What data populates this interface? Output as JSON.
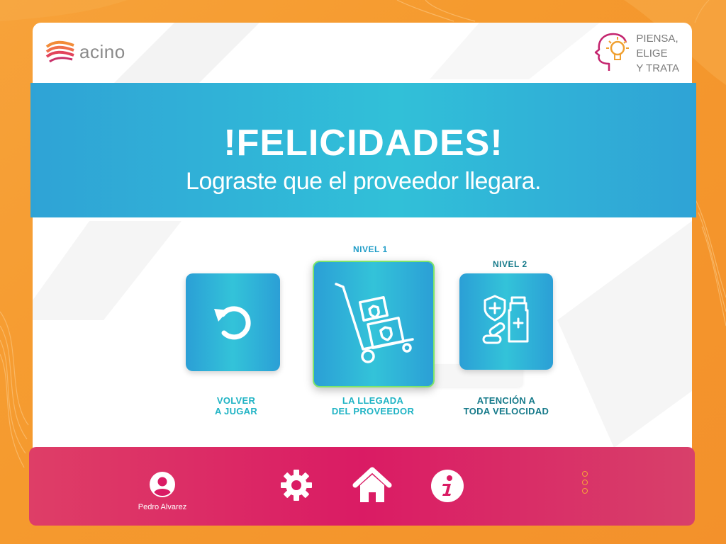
{
  "header": {
    "logo_text": "acino",
    "brand_text": "PIENSA,\nELIGE\nY TRATA"
  },
  "banner": {
    "title": "!FELICIDADES!",
    "subtitle": "Lograste que el proveedor llegara."
  },
  "tiles": [
    {
      "level": "",
      "caption": "VOLVER\nA JUGAR",
      "icon": "replay-icon"
    },
    {
      "level": "NIVEL 1",
      "caption": "LA LLEGADA\nDEL PROVEEDOR",
      "icon": "hand-truck-icon",
      "selected": true
    },
    {
      "level": "NIVEL 2",
      "caption": "ATENCIÓN A\nTODA VELOCIDAD",
      "icon": "medicine-icon"
    }
  ],
  "footer": {
    "user_name": "Pedro Alvarez",
    "icons": [
      "user-avatar-icon",
      "gear-icon",
      "home-icon",
      "info-icon",
      "more-dots-icon"
    ]
  },
  "colors": {
    "background": "#f59a2e",
    "banner": "#31b6d8",
    "footer": "#da1b64",
    "tile": "#2fb0d8",
    "selected_border": "#7ee46a"
  }
}
